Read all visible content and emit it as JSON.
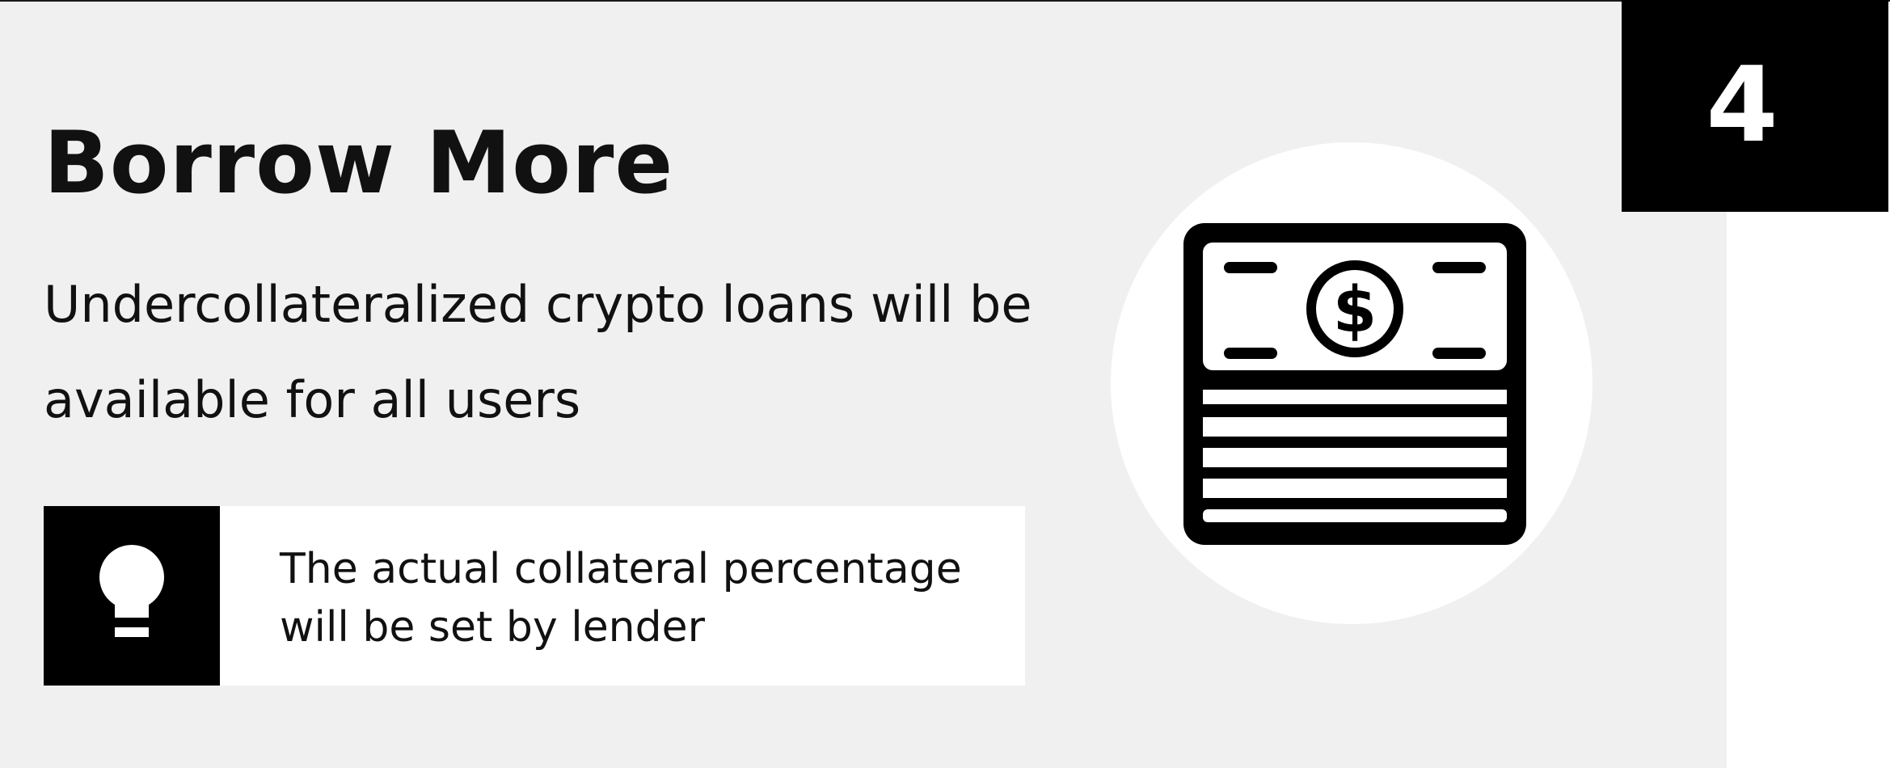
{
  "slide": {
    "number": "4",
    "title": "Borrow More",
    "subtitle": "Undercollateralized crypto loans will be available for all users",
    "tip": {
      "text": "The actual collateral percentage will be set by lender",
      "icon": "lightbulb-icon"
    },
    "illustration": {
      "icon": "money-stack-icon"
    }
  },
  "colors": {
    "background": "#f0f0f0",
    "accent": "#000000",
    "panel": "#ffffff",
    "text": "#111111"
  }
}
